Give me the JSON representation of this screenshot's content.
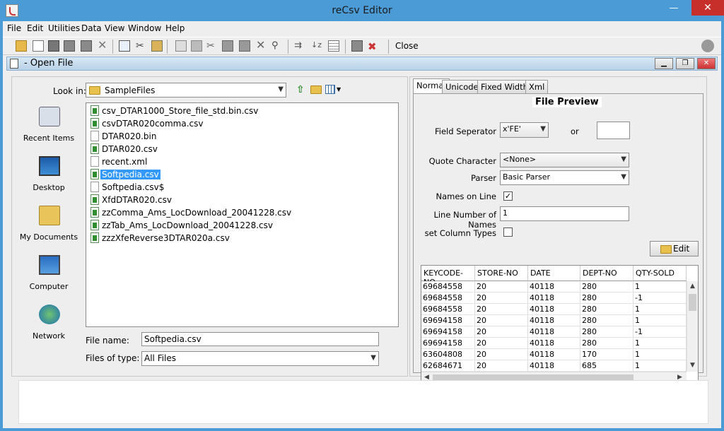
{
  "window": {
    "title": "reCsv Editor"
  },
  "menu": [
    "File",
    "Edit",
    "Utilities",
    "Data",
    "View",
    "Window",
    "Help"
  ],
  "toolbar": {
    "close_label": "Close"
  },
  "inner_frame": {
    "title": "- Open File"
  },
  "chooser": {
    "lookin_label": "Look in:",
    "lookin_value": "SampleFiles",
    "places": [
      "Recent Items",
      "Desktop",
      "My Documents",
      "Computer",
      "Network"
    ],
    "files": [
      {
        "name": "csv_DTAR1000_Store_file_std.bin.csv",
        "kind": "csv"
      },
      {
        "name": "csvDTAR020comma.csv",
        "kind": "csv"
      },
      {
        "name": "DTAR020.bin",
        "kind": "plain"
      },
      {
        "name": "DTAR020.csv",
        "kind": "csv"
      },
      {
        "name": "recent.xml",
        "kind": "plain"
      },
      {
        "name": "Softpedia.csv",
        "kind": "csv",
        "selected": true
      },
      {
        "name": "Softpedia.csv$",
        "kind": "plain"
      },
      {
        "name": "XfdDTAR020.csv",
        "kind": "csv"
      },
      {
        "name": "zzComma_Ams_LocDownload_20041228.csv",
        "kind": "csv"
      },
      {
        "name": "zzTab_Ams_LocDownload_20041228.csv",
        "kind": "csv"
      },
      {
        "name": "zzzXfeReverse3DTAR020a.csv",
        "kind": "csv"
      }
    ],
    "filename_label": "File name:",
    "filename_value": "Softpedia.csv",
    "filetype_label": "Files of type:",
    "filetype_value": "All Files"
  },
  "tabs": [
    "Normal",
    "Unicode",
    "Fixed Width",
    "Xml"
  ],
  "preview": {
    "title": "File Preview",
    "field_separator_label": "Field Seperator",
    "field_separator_value": "x'FE'",
    "or_label": "or",
    "quote_label": "Quote Character",
    "quote_value": "<None>",
    "parser_label": "Parser",
    "parser_value": "Basic Parser",
    "names_on_line_label": "Names on Line",
    "line_number_label": "Line Number of Names",
    "line_number_value": "1",
    "set_column_types_label": "set Column Types",
    "edit_label": "Edit"
  },
  "table": {
    "columns": [
      "KEYCODE-NO",
      "STORE-NO",
      "DATE",
      "DEPT-NO",
      "QTY-SOLD"
    ],
    "rows": [
      [
        "69684558",
        "20",
        "40118",
        "280",
        "1"
      ],
      [
        "69684558",
        "20",
        "40118",
        "280",
        "-1"
      ],
      [
        "69684558",
        "20",
        "40118",
        "280",
        "1"
      ],
      [
        "69694158",
        "20",
        "40118",
        "280",
        "1"
      ],
      [
        "69694158",
        "20",
        "40118",
        "280",
        "-1"
      ],
      [
        "69694158",
        "20",
        "40118",
        "280",
        "1"
      ],
      [
        "63604808",
        "20",
        "40118",
        "170",
        "1"
      ],
      [
        "62684671",
        "20",
        "40118",
        "685",
        "1"
      ]
    ]
  }
}
